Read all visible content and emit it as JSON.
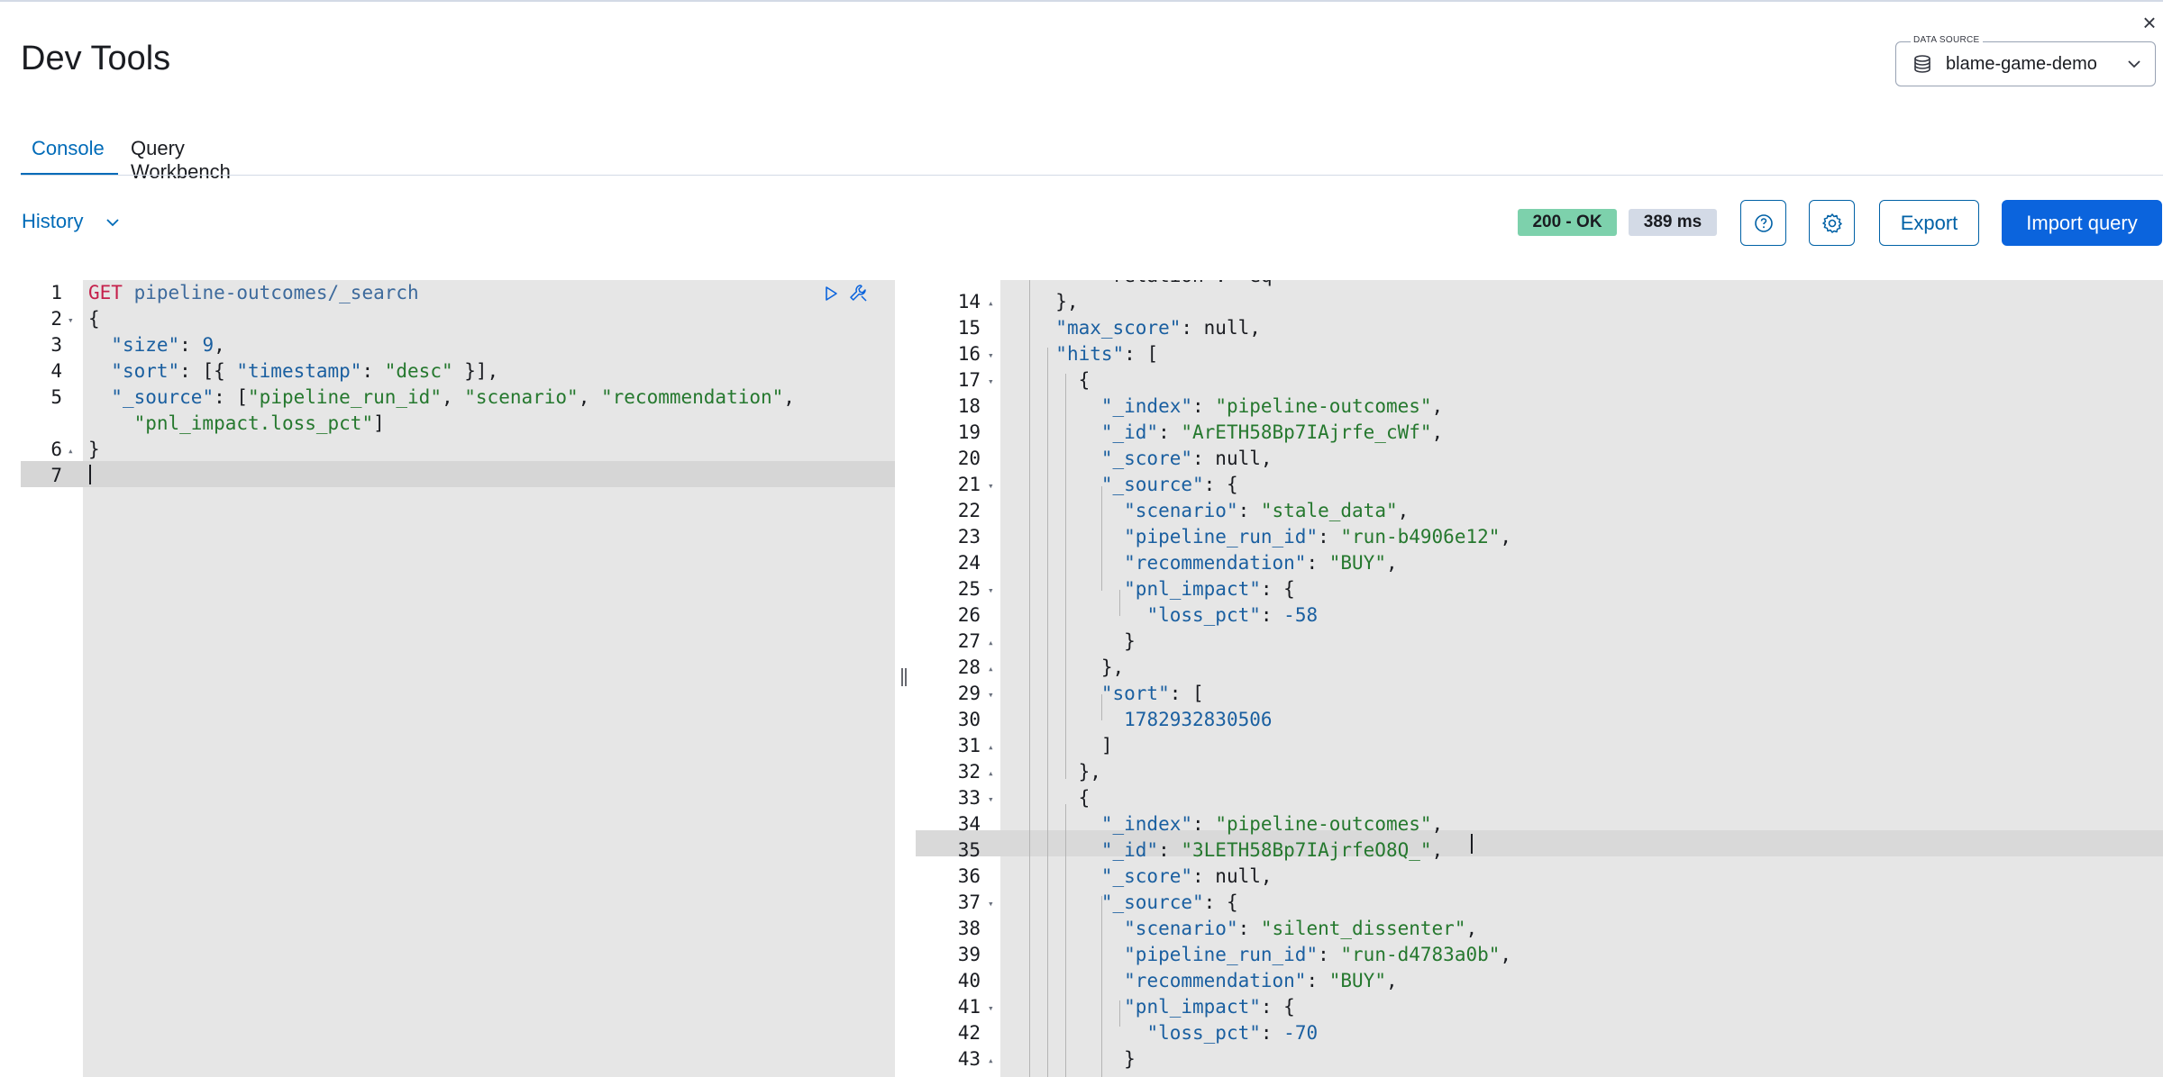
{
  "header": {
    "title": "Dev Tools",
    "close_label": "×"
  },
  "data_source": {
    "legend": "DATA SOURCE",
    "value": "blame-game-demo"
  },
  "tabs": [
    {
      "label": "Console",
      "active": true
    },
    {
      "label": "Query Workbench",
      "active": false
    }
  ],
  "toolbar": {
    "history_label": "History",
    "status": "200 - OK",
    "duration": "389 ms",
    "export_label": "Export",
    "import_label": "Import query",
    "status_color": "#7dd1ac",
    "primary_color": "#0b64dd"
  },
  "request": {
    "lines": [
      {
        "n": "1",
        "fold": ""
      },
      {
        "n": "2",
        "fold": "▾"
      },
      {
        "n": "3",
        "fold": ""
      },
      {
        "n": "4",
        "fold": ""
      },
      {
        "n": "5",
        "fold": ""
      },
      {
        "n": "",
        "fold": ""
      },
      {
        "n": "6",
        "fold": "▴"
      },
      {
        "n": "7",
        "fold": ""
      }
    ],
    "method": "GET",
    "path": "pipeline-outcomes/_search"
  },
  "response": {
    "lines": [
      {
        "n": "14",
        "fold": "▴"
      },
      {
        "n": "15",
        "fold": ""
      },
      {
        "n": "16",
        "fold": "▾"
      },
      {
        "n": "17",
        "fold": "▾"
      },
      {
        "n": "18",
        "fold": ""
      },
      {
        "n": "19",
        "fold": ""
      },
      {
        "n": "20",
        "fold": ""
      },
      {
        "n": "21",
        "fold": "▾"
      },
      {
        "n": "22",
        "fold": ""
      },
      {
        "n": "23",
        "fold": ""
      },
      {
        "n": "24",
        "fold": ""
      },
      {
        "n": "25",
        "fold": "▾"
      },
      {
        "n": "26",
        "fold": ""
      },
      {
        "n": "27",
        "fold": "▴"
      },
      {
        "n": "28",
        "fold": "▴"
      },
      {
        "n": "29",
        "fold": "▾"
      },
      {
        "n": "30",
        "fold": ""
      },
      {
        "n": "31",
        "fold": "▴"
      },
      {
        "n": "32",
        "fold": "▴"
      },
      {
        "n": "33",
        "fold": "▾"
      },
      {
        "n": "34",
        "fold": ""
      },
      {
        "n": "35",
        "fold": ""
      },
      {
        "n": "36",
        "fold": ""
      },
      {
        "n": "37",
        "fold": "▾"
      },
      {
        "n": "38",
        "fold": ""
      },
      {
        "n": "39",
        "fold": ""
      },
      {
        "n": "40",
        "fold": ""
      },
      {
        "n": "41",
        "fold": "▾"
      },
      {
        "n": "42",
        "fold": ""
      },
      {
        "n": "43",
        "fold": "▴"
      }
    ]
  },
  "icons": {
    "close": "close-icon",
    "database": "database-icon",
    "chevron": "chevron-down-icon",
    "run": "play-icon",
    "wrench": "wrench-icon",
    "help": "help-icon",
    "settings": "gear-icon"
  }
}
